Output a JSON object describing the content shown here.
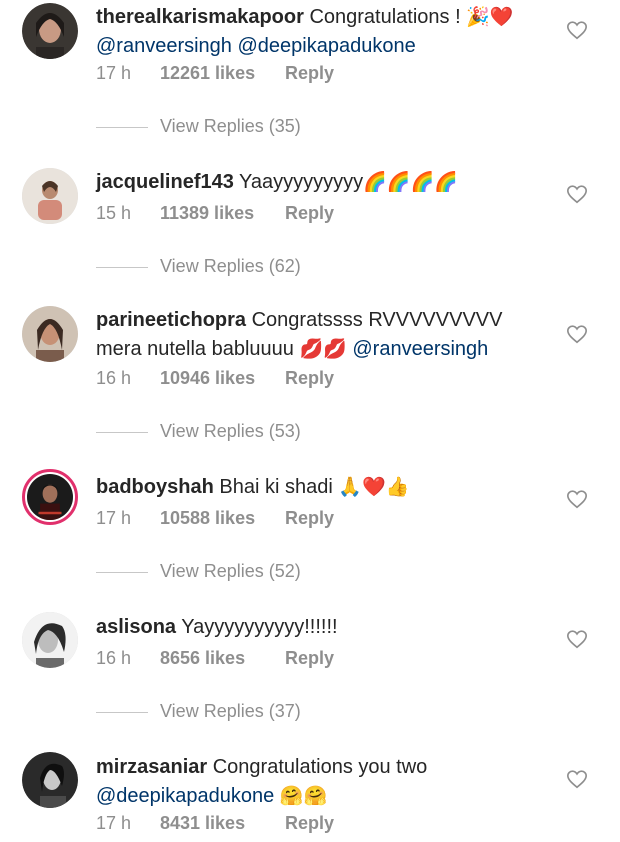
{
  "comments": [
    {
      "username": "therealkarismakapoor",
      "text": "Congratulations !",
      "emoji": "🎉❤️",
      "line2_mention_a": "@ranveersingh",
      "line2_mention_b": "@deepikapadukone",
      "time": "17 h",
      "likes": "12261 likes",
      "reply": "Reply",
      "view_replies": "View Replies (35)"
    },
    {
      "username": "jacquelinef143",
      "text": "Yaayyyyyyyyy",
      "emoji": "🌈🌈🌈🌈",
      "time": "15 h",
      "likes": "11389 likes",
      "reply": "Reply",
      "view_replies": "View Replies (62)"
    },
    {
      "username": "parineetichopra",
      "text": "Congratssss RVVVVVVVVV",
      "line2_text": "mera nutella babluuuu",
      "emoji": "💋💋",
      "line2_mention_a": "@ranveersingh",
      "time": "16 h",
      "likes": "10946 likes",
      "reply": "Reply",
      "view_replies": "View Replies (53)"
    },
    {
      "username": "badboyshah",
      "text": "Bhai ki shadi",
      "emoji": "🙏❤️👍",
      "time": "17 h",
      "likes": "10588 likes",
      "reply": "Reply",
      "view_replies": "View Replies (52)"
    },
    {
      "username": "aslisona",
      "text": "Yayyyyyyyyyy!!!!!!",
      "time": "16 h",
      "likes": "8656 likes",
      "reply": "Reply",
      "view_replies": "View Replies (37)"
    },
    {
      "username": "mirzasaniar",
      "text": "Congratulations you two",
      "line2_mention_a": "@deepikapadukone",
      "emoji": "🤗🤗",
      "time": "17 h",
      "likes": "8431 likes",
      "reply": "Reply"
    }
  ],
  "icons": {
    "like": "heart-outline-icon",
    "avatar": "avatar"
  },
  "colors": {
    "mention": "#003569",
    "meta": "#8e8e8e",
    "story_ring": "#e1306c"
  }
}
